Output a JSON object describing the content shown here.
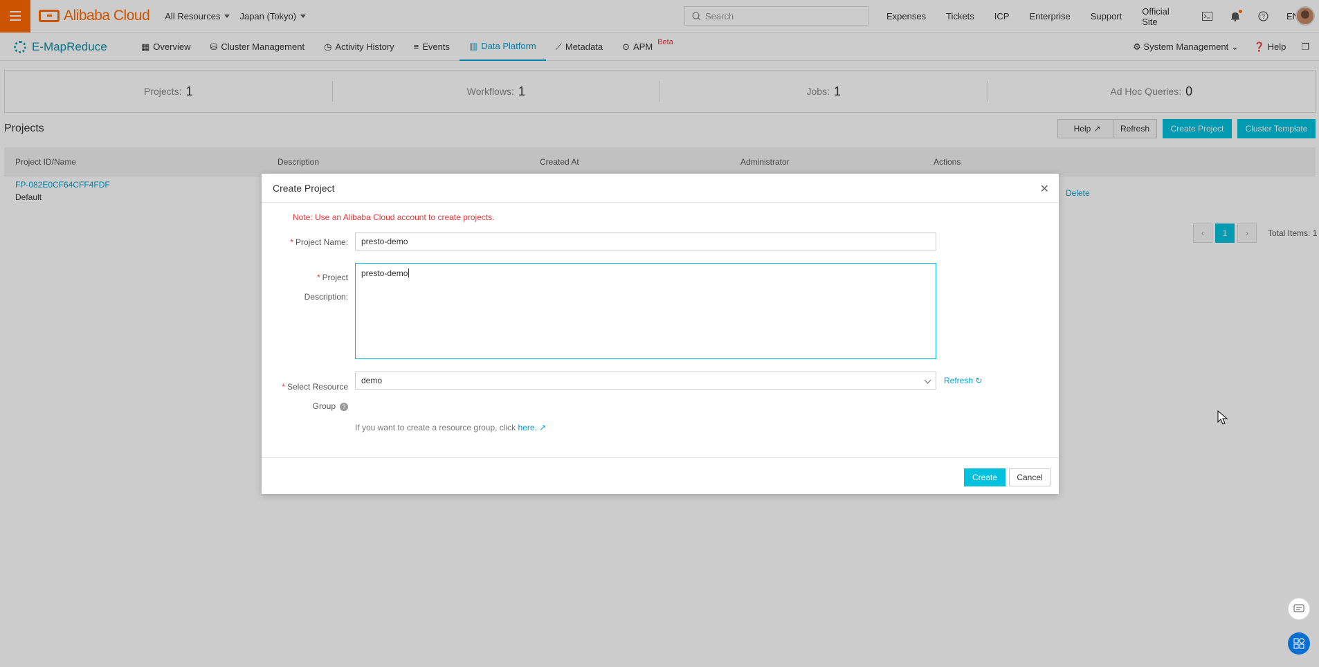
{
  "topbar": {
    "brand": "Alibaba Cloud",
    "resources_label": "All Resources",
    "region_label": "Japan (Tokyo)",
    "search_placeholder": "Search",
    "links": [
      "Expenses",
      "Tickets",
      "ICP",
      "Enterprise",
      "Support",
      "Official Site"
    ],
    "lang": "EN"
  },
  "subnav": {
    "product": "E-MapReduce",
    "items": [
      {
        "label": "Overview",
        "icon": "grid-icon"
      },
      {
        "label": "Cluster Management",
        "icon": "cluster-icon"
      },
      {
        "label": "Activity History",
        "icon": "clock-icon"
      },
      {
        "label": "Events",
        "icon": "list-icon"
      },
      {
        "label": "Data Platform",
        "icon": "bar-chart-icon"
      },
      {
        "label": "Metadata",
        "icon": "metadata-icon"
      },
      {
        "label": "APM",
        "icon": "apm-icon"
      }
    ],
    "beta": "Beta",
    "system_management": "System Management",
    "help": "Help"
  },
  "stats": [
    {
      "label": "Projects:",
      "value": "1"
    },
    {
      "label": "Workflows:",
      "value": "1"
    },
    {
      "label": "Jobs:",
      "value": "1"
    },
    {
      "label": "Ad Hoc Queries:",
      "value": "0"
    }
  ],
  "projects": {
    "title": "Projects",
    "buttons": {
      "help": "Help",
      "refresh": "Refresh",
      "create": "Create Project",
      "template": "Cluster Template"
    },
    "columns": [
      "Project ID/Name",
      "Description",
      "Created At",
      "Administrator",
      "Actions"
    ],
    "rows": [
      {
        "id": "FP-082E0CF64CFF4FDF",
        "name": "Default",
        "action": "Delete"
      }
    ],
    "pager": {
      "current": "1",
      "total": "Total Items: 1"
    }
  },
  "modal": {
    "title": "Create Project",
    "note": "Note: Use an Alibaba Cloud account to create projects.",
    "name_label": "Project Name:",
    "name_value": "presto-demo",
    "desc_label_1": "Project",
    "desc_label_2": "Description:",
    "desc_value": "presto-demo",
    "rg_label_1": "Select Resource",
    "rg_label_2": "Group",
    "rg_value": "demo",
    "refresh": "Refresh",
    "hint": "If you want to create a resource group, click",
    "hint_link": "here.",
    "create": "Create",
    "cancel": "Cancel"
  }
}
